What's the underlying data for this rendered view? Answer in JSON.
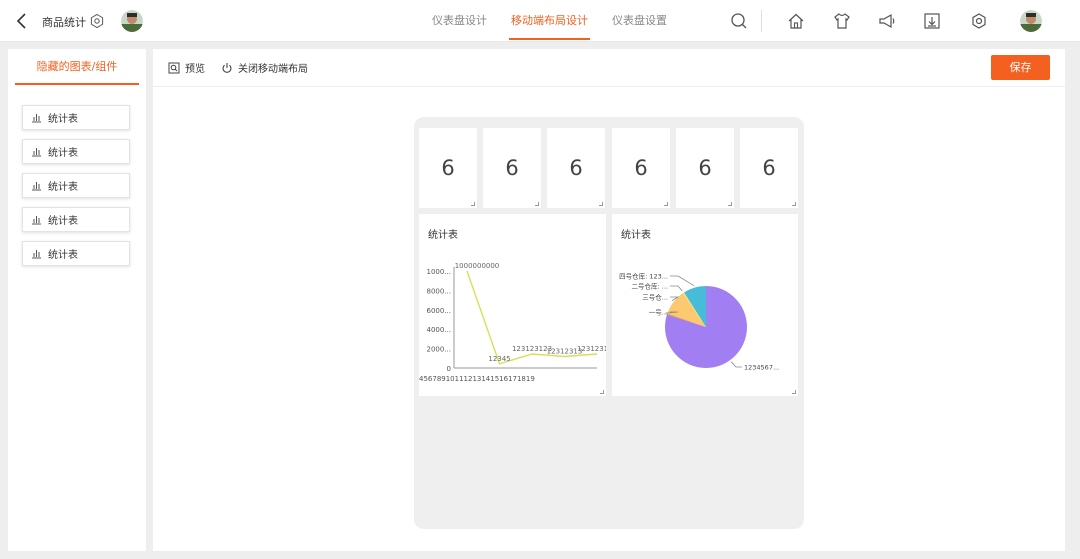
{
  "header": {
    "app_title": "商品统计",
    "tabs": [
      {
        "label": "仪表盘设计",
        "active": false
      },
      {
        "label": "移动端布局设计",
        "active": true
      },
      {
        "label": "仪表盘设置",
        "active": false
      }
    ],
    "icons": [
      "search-icon",
      "home-icon",
      "shirt-icon",
      "megaphone-icon",
      "download-icon",
      "gear-icon"
    ]
  },
  "sidebar": {
    "tab_label": "隐藏的图表/组件",
    "items": [
      {
        "label": "统计表"
      },
      {
        "label": "统计表"
      },
      {
        "label": "统计表"
      },
      {
        "label": "统计表"
      },
      {
        "label": "统计表"
      }
    ]
  },
  "toolbar": {
    "preview_label": "预览",
    "close_mobile_label": "关闭移动端布局",
    "save_label": "保存"
  },
  "number_cards": [
    "6",
    "6",
    "6",
    "6",
    "6",
    "6"
  ],
  "colors": {
    "accent": "#f3601f",
    "line": "#d4e157",
    "pie": [
      "#a17ff2",
      "#fcc970",
      "#46bcd8"
    ]
  },
  "charts": [
    {
      "title": "统计表",
      "chart_data": {
        "type": "line",
        "y_ticks": [
          "1000...",
          "8000...",
          "6000...",
          "4000...",
          "2000...",
          "0"
        ],
        "x_axis_text": "45678910111213141516171819",
        "values": [
          1000000000,
          12345,
          123123123,
          12312313,
          123123123
        ],
        "value_labels": [
          "1000000000",
          "12345",
          "123123123",
          "12312313",
          "123123123"
        ],
        "ylim": [
          0,
          1000000000
        ]
      }
    },
    {
      "title": "统计表",
      "chart_data": {
        "type": "pie",
        "slices": [
          {
            "label": "1234567...",
            "value": 80
          },
          {
            "label": "一号...",
            "value": 0.5
          },
          {
            "label": "三号仓...",
            "value": 10
          },
          {
            "label": "二号仓库: ...",
            "value": 0.5
          },
          {
            "label": "四号仓库: 123...",
            "value": 9
          }
        ]
      }
    }
  ]
}
